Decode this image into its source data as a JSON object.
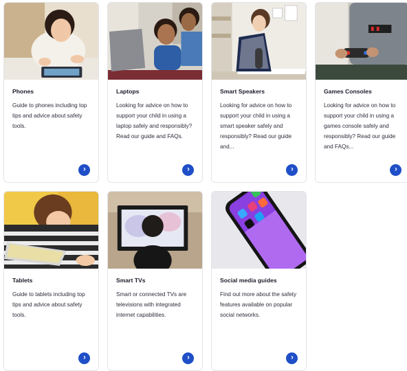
{
  "cards": [
    {
      "title": "Phones",
      "desc": "Guide to phones including top tips and advice about safety tools.",
      "icon": "chevron-right-icon"
    },
    {
      "title": "Laptops",
      "desc": "Looking for advice on how to support your child in using a laptop safely and responsibly? Read our guide and FAQs.",
      "icon": "chevron-right-icon"
    },
    {
      "title": "Smart Speakers",
      "desc": "Looking for advice on how to support your child in using a smart speaker safely and responsibly? Read our guide and...",
      "icon": "chevron-right-icon"
    },
    {
      "title": "Games Consoles",
      "desc": "Looking for advice on how to support your child in using a games console safely and responsibly? Read our guide and FAQs...",
      "icon": "chevron-right-icon"
    },
    {
      "title": "Tablets",
      "desc": "Guide to tablets including top tips and advice about safety tools.",
      "icon": "chevron-right-icon"
    },
    {
      "title": "Smart TVs",
      "desc": "Smart or connected TVs are televisions with integrated internet capabilities.",
      "icon": "chevron-right-icon"
    },
    {
      "title": "Social media guides",
      "desc": "Find out more about the safety features available on popular social networks.",
      "icon": "chevron-right-icon"
    }
  ],
  "colors": {
    "accent": "#1f4fc7",
    "card_border": "#e2e4ea",
    "text": "#1b1b2b"
  },
  "arrow_glyph": "›"
}
